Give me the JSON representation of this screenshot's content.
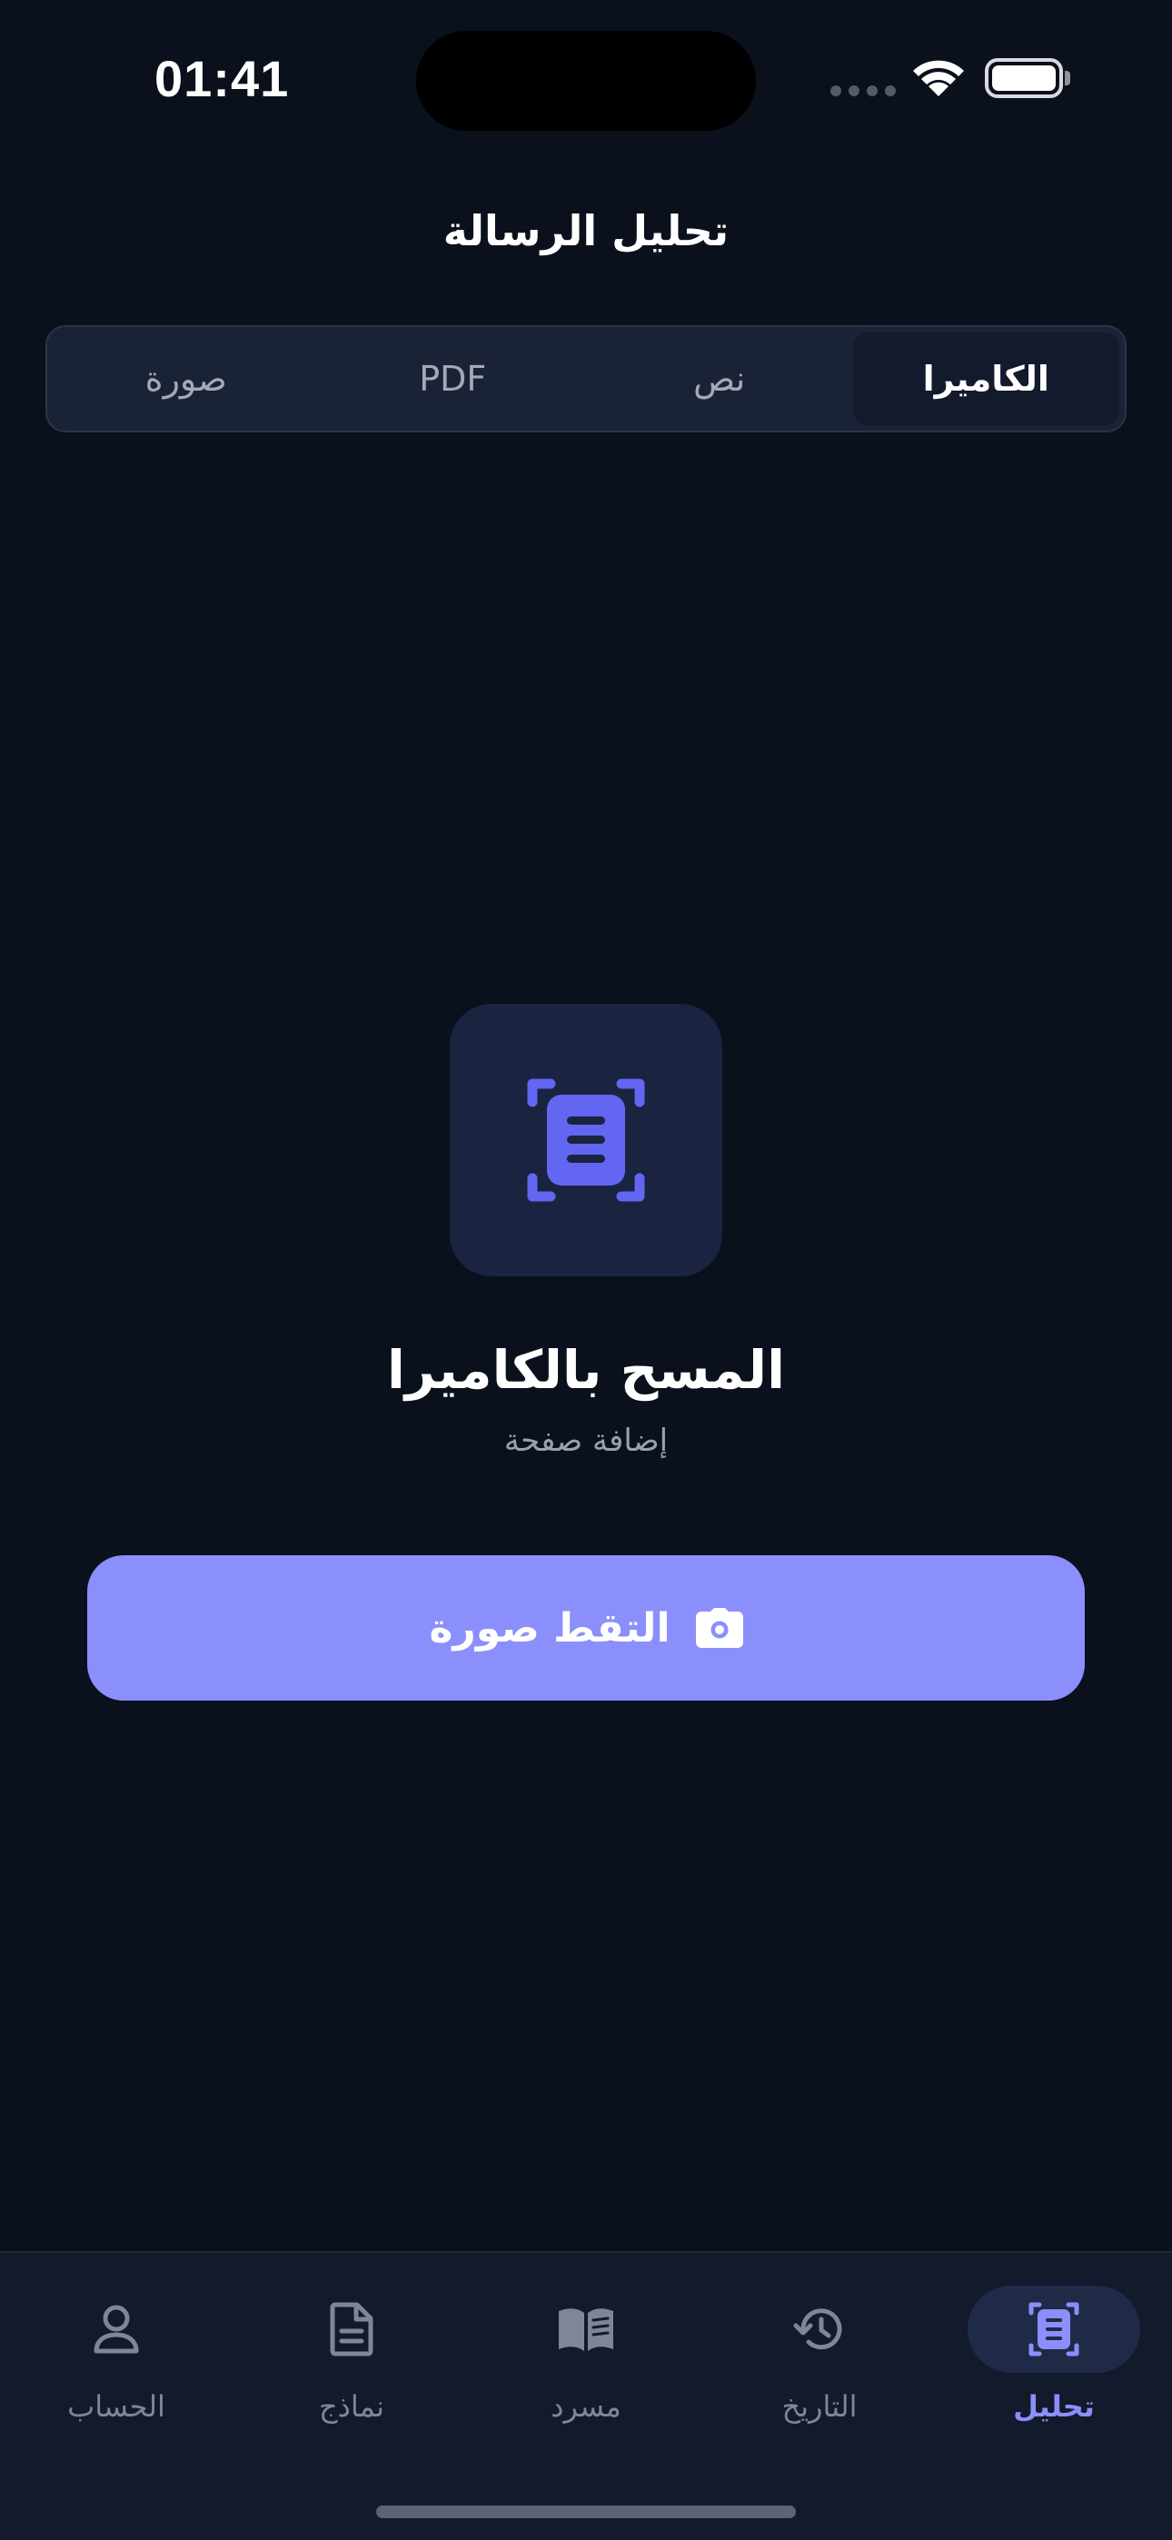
{
  "status_bar": {
    "time": "01:41"
  },
  "header": {
    "title": "تحليل الرسالة"
  },
  "segments": {
    "items": [
      {
        "label": "الكاميرا",
        "active": true
      },
      {
        "label": "نص",
        "active": false
      },
      {
        "label": "PDF",
        "active": false
      },
      {
        "label": "صورة",
        "active": false
      }
    ]
  },
  "scan": {
    "icon": "document-scan-icon",
    "title": "المسح بالكاميرا",
    "subtitle": "إضافة صفحة"
  },
  "capture_button": {
    "label": "التقط صورة",
    "icon": "camera-icon"
  },
  "tabbar": {
    "items": [
      {
        "label": "تحليل",
        "icon": "document-scan-icon",
        "active": true
      },
      {
        "label": "التاريخ",
        "icon": "history-icon",
        "active": false
      },
      {
        "label": "مسرد",
        "icon": "open-book-icon",
        "active": false
      },
      {
        "label": "نماذج",
        "icon": "document-icon",
        "active": false
      },
      {
        "label": "الحساب",
        "icon": "person-icon",
        "active": false
      }
    ]
  },
  "colors": {
    "background": "#0a101c",
    "accent": "#8b8ffb",
    "accent_dark": "#6366f1",
    "surface": "#1a2335"
  }
}
